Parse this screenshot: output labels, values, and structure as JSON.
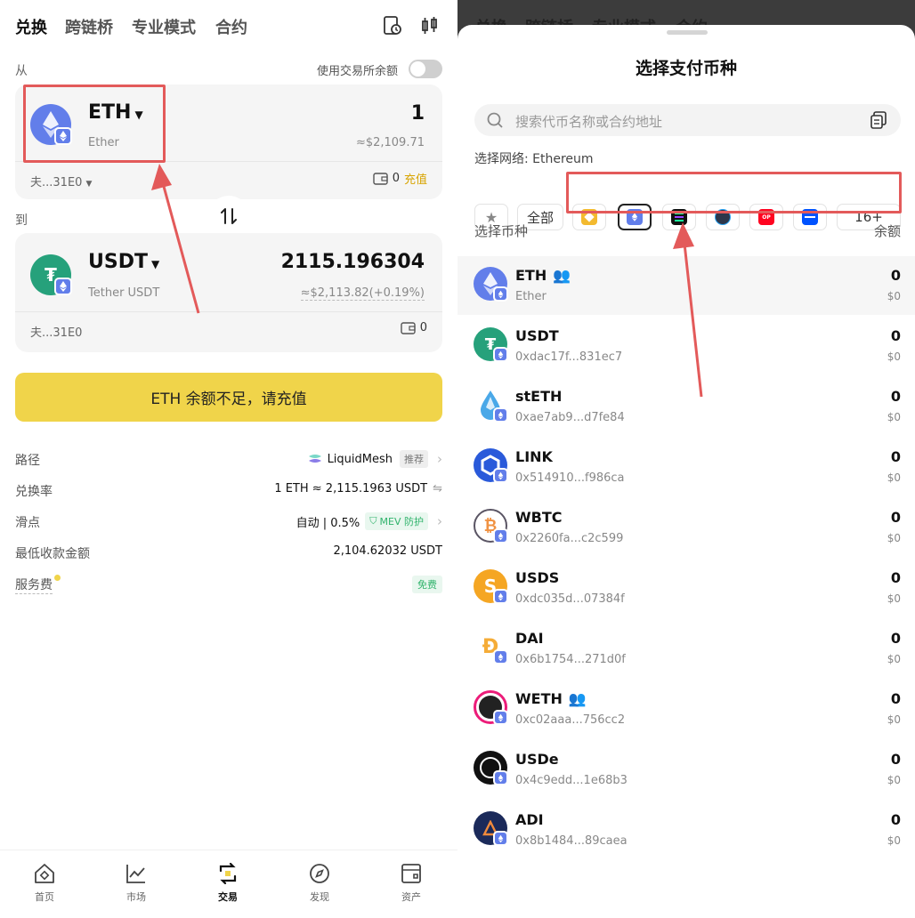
{
  "left": {
    "tabs": [
      "兑换",
      "跨链桥",
      "专业模式",
      "合约"
    ],
    "from_label": "从",
    "use_exchange_balance": "使用交易所余额",
    "from": {
      "symbol": "ETH",
      "name": "Ether",
      "amount": "1",
      "usd": "≈$2,109.71",
      "account": "夫...31E0",
      "balance": "0",
      "deposit": "充值"
    },
    "to_label": "到",
    "to": {
      "symbol": "USDT",
      "name": "Tether USDT",
      "amount": "2115.196304",
      "usd": "≈$2,113.82(+0.19%)",
      "account": "夫...31E0",
      "balance": "0"
    },
    "cta": "ETH 余额不足，请充值",
    "details": {
      "route_label": "路径",
      "route_value": "LiquidMesh",
      "route_tag": "推荐",
      "rate_label": "兑换率",
      "rate_value": "1 ETH ≈ 2,115.1963 USDT",
      "slippage_label": "滑点",
      "slippage_value": "自动 | 0.5%",
      "mev_tag": "MEV 防护",
      "min_label": "最低收款金额",
      "min_value": "2,104.62032 USDT",
      "fee_label": "服务费",
      "fee_tag": "免费"
    },
    "nav": [
      "首页",
      "市场",
      "交易",
      "发现",
      "资产"
    ]
  },
  "right": {
    "bg_tabs": [
      "兑换",
      "跨链桥",
      "专业模式",
      "合约"
    ],
    "title": "选择支付币种",
    "search_placeholder": "搜索代币名称或合约地址",
    "network_label": "选择网络: Ethereum",
    "all_label": "全部",
    "more_networks": "16+",
    "list_header_left": "选择币种",
    "list_header_right": "余额",
    "tokens": [
      {
        "symbol": "ETH",
        "sub": "Ether",
        "balance": "0",
        "usd": "$0"
      },
      {
        "symbol": "USDT",
        "sub": "0xdac17f...831ec7",
        "balance": "0",
        "usd": "$0"
      },
      {
        "symbol": "stETH",
        "sub": "0xae7ab9...d7fe84",
        "balance": "0",
        "usd": "$0"
      },
      {
        "symbol": "LINK",
        "sub": "0x514910...f986ca",
        "balance": "0",
        "usd": "$0"
      },
      {
        "symbol": "WBTC",
        "sub": "0x2260fa...c2c599",
        "balance": "0",
        "usd": "$0"
      },
      {
        "symbol": "USDS",
        "sub": "0xdc035d...07384f",
        "balance": "0",
        "usd": "$0"
      },
      {
        "symbol": "DAI",
        "sub": "0x6b1754...271d0f",
        "balance": "0",
        "usd": "$0"
      },
      {
        "symbol": "WETH",
        "sub": "0xc02aaa...756cc2",
        "balance": "0",
        "usd": "$0"
      },
      {
        "symbol": "USDe",
        "sub": "0x4c9edd...1e68b3",
        "balance": "0",
        "usd": "$0"
      },
      {
        "symbol": "ADI",
        "sub": "0x8b1484...89caea",
        "balance": "0",
        "usd": "$0"
      }
    ]
  },
  "colors": {
    "accent_yellow": "#f0d44a",
    "eth_purple": "#627eea",
    "usdt_green": "#26a17b",
    "highlight_red": "#e35a5a",
    "deposit_gold": "#d8a400",
    "free_green": "#2fb36b"
  }
}
